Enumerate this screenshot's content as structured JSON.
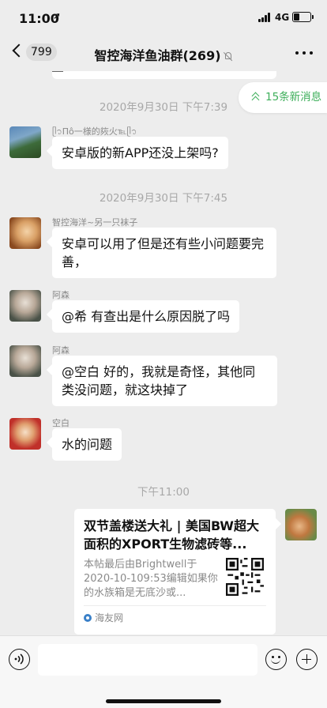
{
  "status_bar": {
    "time": "11:00",
    "location_icon": "location-arrow-icon",
    "network": "4G",
    "battery_level": 0.35
  },
  "nav": {
    "unread_count": "799",
    "title": "智控海洋鱼油群(269)",
    "back_icon": "chevron-left-icon",
    "muted_icon": "bell-slash-icon",
    "more_icon": "ellipsis-icon"
  },
  "new_messages": {
    "label": "15条新消息",
    "icon": "double-chevron-up-icon"
  },
  "chat": {
    "time_dividers": [
      "2020年9月30日 下午7:39",
      "2020年9月30日 下午7:45",
      "下午11:00"
    ],
    "messages": [
      {
        "sender": "ᥫ᭡Πô一様的㷇火℡ᥫ᭡",
        "text": "安卓版的新APP还没上架吗?"
      },
      {
        "sender": "智控海洋~另一只袜子",
        "text": "安卓可以用了但是还有些小问题要完善，"
      },
      {
        "sender": "阿森",
        "text": "@希 有查出是什么原因脱了吗"
      },
      {
        "sender": "阿森",
        "text": "@空白 好的，我就是奇怪，其他同类没问题，就这块掉了"
      },
      {
        "sender": "空白",
        "text": "水的问题"
      }
    ],
    "card": {
      "title": "双节盖楼送大礼 | 美国BW超大面积的XPORT生物滤砖等...",
      "description": "本帖最后由Brightwell于2020-10-109:53编辑如果你的水族箱是无底沙或...",
      "source": "海友网",
      "source_icon": "source-logo-icon",
      "qr_icon": "qr-code-icon"
    }
  },
  "input_bar": {
    "voice_icon": "voice-icon",
    "emoji_icon": "emoji-icon",
    "plus_icon": "plus-icon",
    "text_value": ""
  },
  "colors": {
    "background": "#ededed",
    "accent_green": "#3eaf5b",
    "muted_text": "#a8a8a8"
  }
}
